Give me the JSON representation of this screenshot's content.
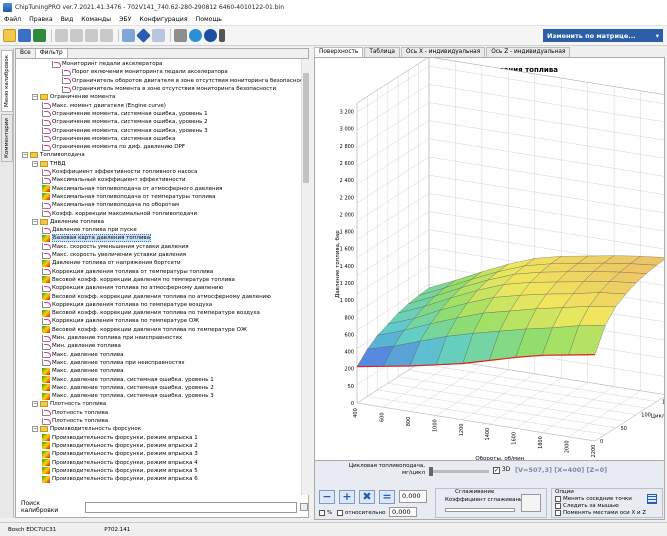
{
  "window": {
    "title": "ChipTuningPRO ver.7.2021.41.3476 - 702V141_740.62-280-290812 6460-4010122-01.bin"
  },
  "menu": [
    "Файл",
    "Правка",
    "Вид",
    "Команды",
    "ЭБУ",
    "Конфигурация",
    "Помощь"
  ],
  "toolbar": {
    "matrix_button": "Изменить по матрице...",
    "matrix_arrow": "▾"
  },
  "left_tabs": {
    "calibrations": "Меню калибровок",
    "comments": "Комментарии"
  },
  "tree_tabs": {
    "all": "Все",
    "filter": "Фильтр"
  },
  "tree": [
    {
      "indent": 4,
      "kind": "curve",
      "label": "Мониторинг педали акселератора"
    },
    {
      "indent": 5,
      "kind": "curve",
      "label": "Порог включения мониторинга педали акселератора"
    },
    {
      "indent": 5,
      "kind": "curve",
      "label": "Ограничитель оборотов двигателя в зоне отсутствия мониторинга безопасности"
    },
    {
      "indent": 5,
      "kind": "curve",
      "label": "Ограничитель момента в зоне отсутствия мониторинга безопасности"
    },
    {
      "indent": 2,
      "kind": "folder",
      "label": "Ограничение момента",
      "exp": "−"
    },
    {
      "indent": 3,
      "kind": "curve",
      "label": "Макс. момент двигателя (Engine curve)"
    },
    {
      "indent": 3,
      "kind": "curve",
      "label": "Ограничение момента, системная ошибка, уровень 1"
    },
    {
      "indent": 3,
      "kind": "curve",
      "label": "Ограничение момента, системная ошибка, уровень 2"
    },
    {
      "indent": 3,
      "kind": "curve",
      "label": "Ограничение момента, системная ошибка, уровень 3"
    },
    {
      "indent": 3,
      "kind": "curve",
      "label": "Ограничение момента, системная ошибка"
    },
    {
      "indent": 3,
      "kind": "curve",
      "label": "Ограничение момента по диф. давлению DPF"
    },
    {
      "indent": 1,
      "kind": "folder",
      "label": "Топливоподача",
      "exp": "−"
    },
    {
      "indent": 2,
      "kind": "folder",
      "label": "ТНВД",
      "exp": "−"
    },
    {
      "indent": 3,
      "kind": "curve",
      "label": "Коэффициент эффективности топливного насоса"
    },
    {
      "indent": 3,
      "kind": "curve",
      "label": "Максимальный коэффициент эффективности"
    },
    {
      "indent": 3,
      "kind": "map",
      "label": "Максимальная топливоподача от атмосферного давления"
    },
    {
      "indent": 3,
      "kind": "map",
      "label": "Максимальная топливоподача от температуры топлива"
    },
    {
      "indent": 3,
      "kind": "curve",
      "label": "Максимальная топливоподача по оборотам"
    },
    {
      "indent": 3,
      "kind": "curve",
      "label": "Коэфф. коррекции максимальной топливоподачи"
    },
    {
      "indent": 2,
      "kind": "folder",
      "label": "Давление топлива",
      "exp": "−"
    },
    {
      "indent": 3,
      "kind": "curve",
      "label": "Давление топлива при пуске"
    },
    {
      "indent": 3,
      "kind": "map",
      "label": "Базовая карта давления топлива",
      "selected": true
    },
    {
      "indent": 3,
      "kind": "curve",
      "label": "Макс. скорость уменьшения уставки давления"
    },
    {
      "indent": 3,
      "kind": "curve",
      "label": "Макс. скорость увеличения уставки давления"
    },
    {
      "indent": 3,
      "kind": "map",
      "label": "Давление топлива от напряжения бортсети"
    },
    {
      "indent": 3,
      "kind": "curve",
      "label": "Коррекция давления топлива от температуры топлива"
    },
    {
      "indent": 3,
      "kind": "map",
      "label": "Весовой коэфф. коррекции давления по температуре топлива"
    },
    {
      "indent": 3,
      "kind": "curve",
      "label": "Коррекция давления топлива по атмосферному давлению"
    },
    {
      "indent": 3,
      "kind": "map",
      "label": "Весовой коэфф. коррекции давления топлива по атмосферному давлению"
    },
    {
      "indent": 3,
      "kind": "curve",
      "label": "Коррекция давления топлива по температуре воздуха"
    },
    {
      "indent": 3,
      "kind": "map",
      "label": "Весовой коэфф. коррекции давления топлива по температуре воздуха"
    },
    {
      "indent": 3,
      "kind": "curve",
      "label": "Коррекция давления топлива по температуре ОЖ"
    },
    {
      "indent": 3,
      "kind": "map",
      "label": "Весовой коэфф. коррекции давления топлива по температуре ОЖ"
    },
    {
      "indent": 3,
      "kind": "curve",
      "label": "Мин. давление топлива при неисправностях"
    },
    {
      "indent": 3,
      "kind": "curve",
      "label": "Мин. давление топлива"
    },
    {
      "indent": 3,
      "kind": "curve",
      "label": "Макс. давление топлива"
    },
    {
      "indent": 3,
      "kind": "curve",
      "label": "Макс. давление топлива при неисправностях"
    },
    {
      "indent": 3,
      "kind": "map",
      "label": "Макс. давление топлива"
    },
    {
      "indent": 3,
      "kind": "map",
      "label": "Макс. давление топлива, системная ошибка, уровень 1"
    },
    {
      "indent": 3,
      "kind": "map",
      "label": "Макс. давление топлива, системная ошибка, уровень 2"
    },
    {
      "indent": 3,
      "kind": "map",
      "label": "Макс. давление топлива, системная ошибка, уровень 3"
    },
    {
      "indent": 2,
      "kind": "folder",
      "label": "Плотность топлива",
      "exp": "−"
    },
    {
      "indent": 3,
      "kind": "curve",
      "label": "Плотность топлива"
    },
    {
      "indent": 3,
      "kind": "curve",
      "label": "Плотность топлива"
    },
    {
      "indent": 2,
      "kind": "folder",
      "label": "Производительность форсунок",
      "exp": "−"
    },
    {
      "indent": 3,
      "kind": "map",
      "label": "Производительность форсунки, режим впрыска 1"
    },
    {
      "indent": 3,
      "kind": "map",
      "label": "Производительность форсунки, режим впрыска 2"
    },
    {
      "indent": 3,
      "kind": "map",
      "label": "Производительность форсунки, режим впрыска 3"
    },
    {
      "indent": 3,
      "kind": "map",
      "label": "Производительность форсунки, режим впрыска 4"
    },
    {
      "indent": 3,
      "kind": "map",
      "label": "Производительность форсунки, режим впрыска 5"
    },
    {
      "indent": 3,
      "kind": "map",
      "label": "Производительность форсунки, режим впрыска 6"
    }
  ],
  "search": {
    "label": "Поиск калибровки",
    "value": ""
  },
  "status": {
    "ecu": "Bosch EDC7UC31",
    "code": "P702.141"
  },
  "right_tabs": [
    "Поверхность",
    "Таблица",
    "Ось X - индивидуальная",
    "Ось Z - индивидуальная"
  ],
  "chart_data": {
    "type": "surface3d",
    "title": "Базовая карта давления топлива",
    "ylabel": "Давление топлива, бар",
    "xlabel": "Обороты, об/мин",
    "zlabel": "Цикловая топ",
    "ylim": [
      0,
      3300
    ],
    "y_ticks": [
      "0",
      "50",
      "200",
      "400",
      "600",
      "800",
      "1 000",
      "1 200",
      "1 400",
      "1 600",
      "1 800",
      "2 000",
      "2 200",
      "2 400",
      "2 600",
      "2 800",
      "3 000",
      "3 200"
    ],
    "x_ticks": [
      "400",
      "600",
      "800",
      "1000",
      "1200",
      "1400",
      "1600",
      "1800",
      "2000",
      "2200"
    ],
    "z_ticks": [
      "0",
      "50",
      "100",
      "150"
    ],
    "x": [
      400,
      600,
      800,
      1000,
      1200,
      1400,
      1600,
      1800,
      2000,
      2200
    ],
    "z": [
      0,
      25,
      50,
      75,
      100,
      125,
      150,
      175
    ],
    "surface": [
      [
        400,
        450,
        500,
        560,
        620,
        700,
        780,
        850,
        900,
        950
      ],
      [
        520,
        600,
        700,
        800,
        880,
        950,
        1020,
        1080,
        1150,
        1200
      ],
      [
        600,
        700,
        820,
        930,
        1030,
        1100,
        1170,
        1230,
        1290,
        1330
      ],
      [
        650,
        760,
        900,
        1020,
        1130,
        1200,
        1260,
        1310,
        1370,
        1400
      ],
      [
        700,
        820,
        960,
        1090,
        1200,
        1270,
        1320,
        1370,
        1420,
        1450
      ],
      [
        730,
        860,
        1000,
        1130,
        1240,
        1310,
        1360,
        1410,
        1450,
        1480
      ],
      [
        750,
        880,
        1020,
        1150,
        1260,
        1330,
        1380,
        1430,
        1470,
        1500
      ],
      [
        760,
        890,
        1030,
        1160,
        1270,
        1340,
        1390,
        1440,
        1480,
        1510
      ]
    ]
  },
  "bottom": {
    "fuel_label_1": "Цикловая топливоподача,",
    "fuel_label_2": "мг/цикл",
    "three_d": "3D",
    "three_d_check": "✓",
    "coords": "[V=507,3] [X=400] [Z=0]",
    "value1": "0,000",
    "value2": "0,000",
    "percent": "%",
    "relative": "относительно",
    "smoothing": "Сглаживание",
    "smoothing_coef": "Коэффициент сглаживания",
    "options_title": "Опции",
    "opt1": "Менять соседние точки",
    "opt2": "Следить за мышью",
    "opt3": "Поменять местами оси X и Z",
    "minus": "−",
    "plus": "+",
    "delete": "✖",
    "eq": "="
  }
}
